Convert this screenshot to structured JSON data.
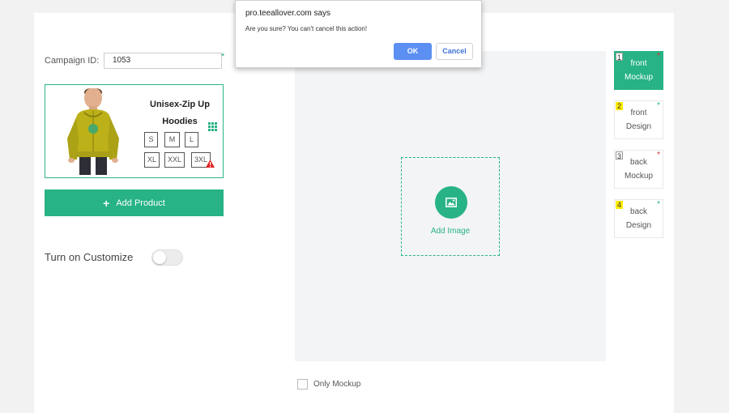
{
  "form": {
    "campaign_label": "Campaign ID:",
    "campaign_value": "1053",
    "required_mark": "*"
  },
  "product": {
    "name": "Unisex-Zip Up Hoodies",
    "sizes": [
      "S",
      "M",
      "L",
      "XL",
      "XXL",
      "3XL"
    ],
    "accent_color": "#27b386"
  },
  "actions": {
    "add_product_icon": "+",
    "add_product_label": "Add Product",
    "customize_label": "Turn on Customize",
    "customize_enabled": false
  },
  "canvas": {
    "add_image_label": "Add Image",
    "only_mockup_label": "Only Mockup",
    "only_mockup_checked": false
  },
  "sides": [
    {
      "num": "1",
      "line1": "front",
      "line2": "Mockup",
      "star_color": "#e03030",
      "active": true
    },
    {
      "num": "2",
      "line1": "front",
      "line2": "Design",
      "star_color": "#27b386",
      "active": false
    },
    {
      "num": "3",
      "line1": "back",
      "line2": "Mockup",
      "star_color": "#e03030",
      "active": false
    },
    {
      "num": "4",
      "line1": "back",
      "line2": "Design",
      "star_color": "#27b386",
      "active": false
    }
  ],
  "dialog": {
    "title": "pro.teeallover.com says",
    "message": "Are you sure? You can't cancel this action!",
    "ok_label": "OK",
    "cancel_label": "Cancel"
  }
}
